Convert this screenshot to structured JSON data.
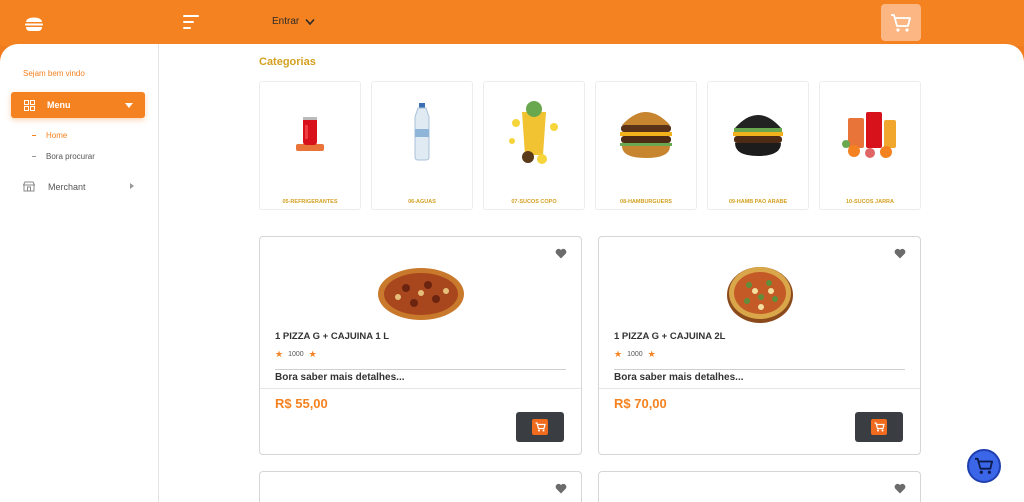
{
  "header": {
    "login_label": "Entrar"
  },
  "sidebar": {
    "welcome": "Sejam bem vindo",
    "menu_label": "Menu",
    "items": [
      {
        "label": "Home",
        "active": true
      },
      {
        "label": "Bora procurar",
        "active": false
      }
    ],
    "merchant_label": "Merchant"
  },
  "categories": {
    "title": "Categorias",
    "items": [
      {
        "label": "05-REFRIGERANTES",
        "icon": "soda-can-image"
      },
      {
        "label": "06-AGUAS",
        "icon": "water-bottle-image"
      },
      {
        "label": "07-SUCOS COPO",
        "icon": "juice-glass-image"
      },
      {
        "label": "08-HAMBURGUERS",
        "icon": "burger-image"
      },
      {
        "label": "09-HAMB PAO ARABE",
        "icon": "black-burger-image"
      },
      {
        "label": "10-SUCOS JARRA",
        "icon": "juice-jar-image"
      }
    ]
  },
  "products": [
    {
      "name": "1 PIZZA G + CAJUINA 1 L",
      "rating_count": "1000",
      "details": "Bora saber mais detalhes...",
      "price": "R$ 55,00"
    },
    {
      "name": "1 PIZZA G + CAJUINA 2L",
      "rating_count": "1000",
      "details": "Bora saber mais detalhes...",
      "price": "R$ 70,00"
    }
  ],
  "colors": {
    "brand_orange": "#f58220",
    "category_gold": "#d4a020",
    "cart_button": "#3a3d42",
    "floating_cart": "#3b66e8"
  }
}
